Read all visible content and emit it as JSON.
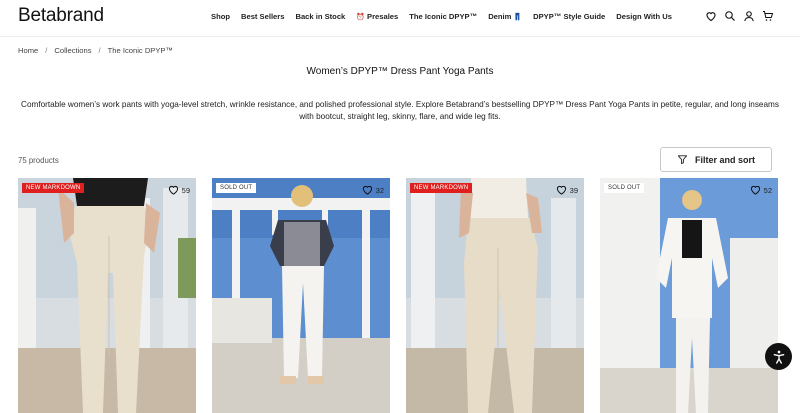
{
  "header": {
    "logo": "Betabrand",
    "nav": [
      {
        "label": "Shop",
        "icon": ""
      },
      {
        "label": "Best Sellers",
        "icon": ""
      },
      {
        "label": "Back in Stock",
        "icon": ""
      },
      {
        "label": "Presales",
        "icon": "⏰"
      },
      {
        "label": "The Iconic DPYP™",
        "icon": ""
      },
      {
        "label": "Denim",
        "icon": "👖"
      },
      {
        "label": "DPYP™ Style Guide",
        "icon": ""
      },
      {
        "label": "Design With Us",
        "icon": ""
      }
    ],
    "icons": [
      "heart-icon",
      "search-icon",
      "account-icon",
      "cart-icon"
    ]
  },
  "breadcrumb": [
    "Home",
    "Collections",
    "The Iconic DPYP™"
  ],
  "page_title": "Women’s DPYP™ Dress Pant Yoga Pants",
  "description": "Comfortable women’s work pants with yoga-level stretch, wrinkle resistance, and polished professional style. Explore Betabrand’s bestselling DPYP™ Dress Pant Yoga Pants in petite, regular, and long inseams with bootcut, straight leg, skinny, flare, and wide leg fits.",
  "product_count": "75 products",
  "filter_label": "Filter and sort",
  "products": [
    {
      "badge": "NEW MARKDOWN",
      "badge_type": "sale",
      "likes": "59"
    },
    {
      "badge": "SOLD OUT",
      "badge_type": "soldout",
      "likes": "32"
    },
    {
      "badge": "NEW MARKDOWN",
      "badge_type": "sale",
      "likes": "39"
    },
    {
      "badge": "SOLD OUT",
      "badge_type": "soldout",
      "likes": "52"
    }
  ],
  "colors": {
    "sale_badge": "#e0201e",
    "pant_cream": "#e6dcc8",
    "sky": "#5d8fd0"
  }
}
